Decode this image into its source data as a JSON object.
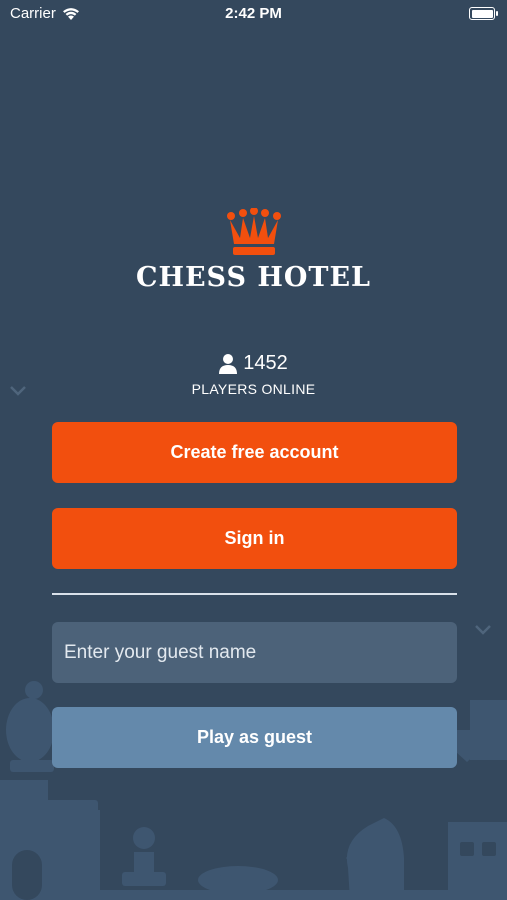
{
  "status_bar": {
    "carrier": "Carrier",
    "time": "2:42 PM"
  },
  "app": {
    "brand": "CHESS HOTEL",
    "players_online_count": "1452",
    "players_online_label": "PLAYERS ONLINE"
  },
  "buttons": {
    "create_account": "Create free account",
    "sign_in": "Sign in",
    "play_guest": "Play as guest"
  },
  "guest_input": {
    "placeholder": "Enter your guest name",
    "value": ""
  },
  "colors": {
    "background": "#34485d",
    "accent_orange": "#f24f0e",
    "guest_button": "#6489ab",
    "input_bg": "#4c6279"
  }
}
